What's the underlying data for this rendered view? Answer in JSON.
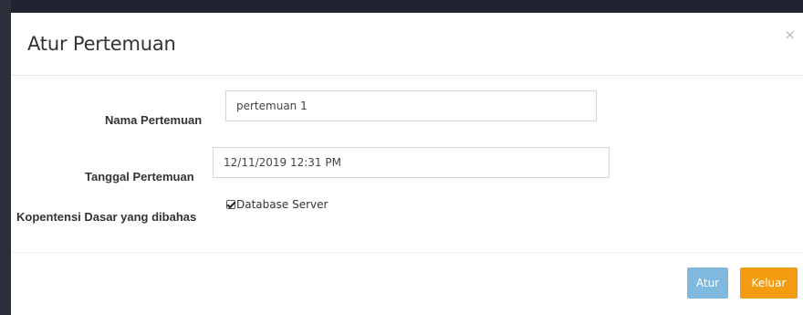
{
  "modal": {
    "title": "Atur Pertemuan",
    "close_label": "×"
  },
  "form": {
    "nama_label": "Nama Pertemuan",
    "nama_value": "pertemuan 1",
    "tanggal_label": "Tanggal Pertemuan",
    "tanggal_value": "12/11/2019 12:31 PM",
    "kompetensi_label": "Kopentensi Dasar yang dibahas",
    "kompetensi_options": [
      {
        "label": "Database Server",
        "checked": true
      }
    ]
  },
  "footer": {
    "atur_label": "Atur",
    "keluar_label": "Keluar"
  },
  "colors": {
    "atur_button": "#80b9de",
    "keluar_button": "#f39c12"
  }
}
